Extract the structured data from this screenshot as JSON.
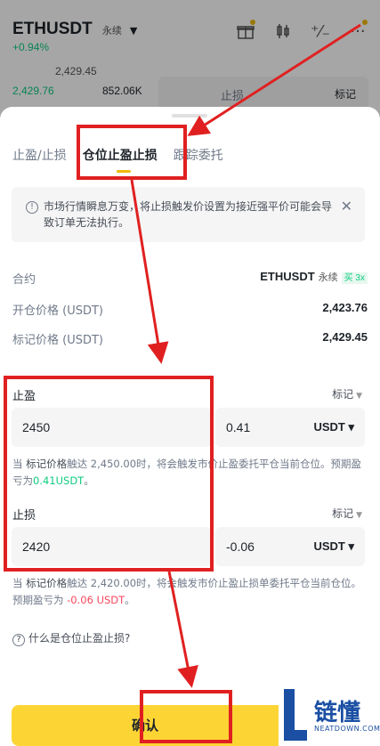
{
  "header": {
    "symbol": "ETHUSDT",
    "perp": "永续",
    "change": "+0.94%"
  },
  "orderbook": {
    "price_top": "2,429.45",
    "bid_price": "2,429.76",
    "bid_qty": "852.06K"
  },
  "bg_form": {
    "field_label": "止损",
    "mark": "标记"
  },
  "tabs": [
    "止盈/止损",
    "仓位止盈止损",
    "跟踪委托"
  ],
  "notice": {
    "text": "市场行情瞬息万变，将止损触发价设置为接近强平价可能会导致订单无法执行。"
  },
  "contract": {
    "label": "合约",
    "symbol": "ETHUSDT",
    "perp": "永续",
    "side": "买 3x"
  },
  "open_price": {
    "label": "开仓价格 (USDT)",
    "value": "2,423.76"
  },
  "mark_price": {
    "label": "标记价格 (USDT)",
    "value": "2,429.45"
  },
  "take_profit": {
    "label": "止盈",
    "trigger": "标记",
    "price": "2450",
    "pnl": "0.41",
    "unit": "USDT",
    "hint_a": "当 ",
    "hint_mark": "标记价格",
    "hint_b": "触达 2,450.00时，将会触发市价止盈委托平仓当前仓位。预期盈亏为",
    "hint_value": "0.41USDT",
    "hint_end": "。"
  },
  "stop_loss": {
    "label": "止损",
    "trigger": "标记",
    "price": "2420",
    "pnl": "-0.06",
    "unit": "USDT",
    "hint_a": "当 ",
    "hint_mark": "标记价格",
    "hint_b": "触达 2,420.00时，将会触发市价止盈止损单委托平仓当前仓位。预期盈亏为 ",
    "hint_value": "-0.06 USDT",
    "hint_end": "。"
  },
  "help": "什么是仓位止盈止损?",
  "confirm": "确认",
  "watermark": {
    "cn": "链懂",
    "en": "NEATDOWN.COM"
  },
  "colors": {
    "accent": "#fcd535",
    "profit": "#0ecb81",
    "loss": "#f6465d",
    "annotation": "#e02020"
  }
}
